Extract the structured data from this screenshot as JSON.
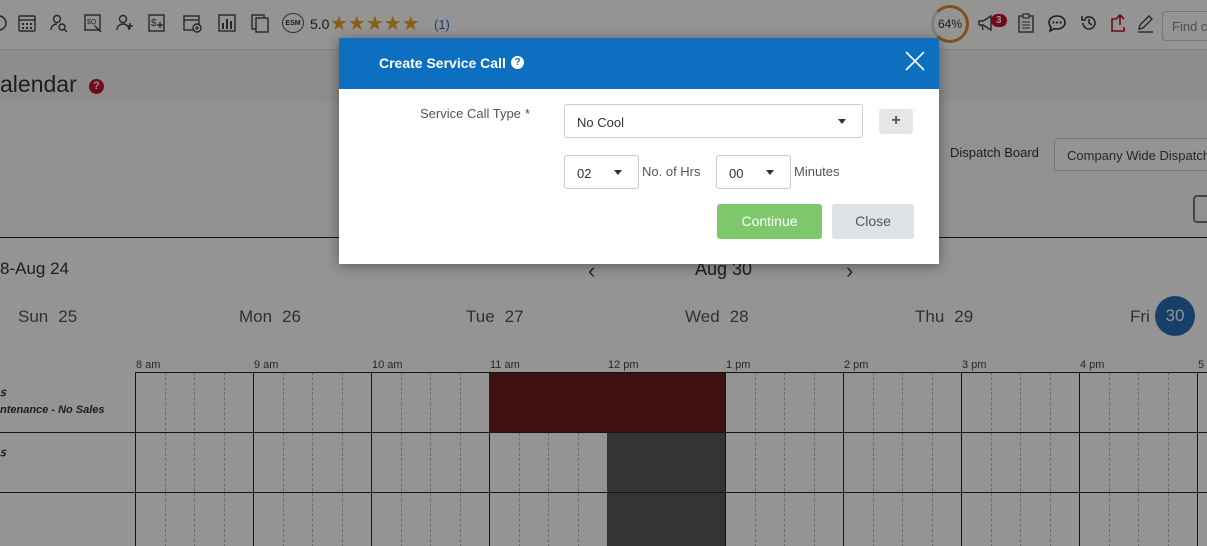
{
  "toolbar": {
    "icons": [
      "calendar-grid-icon",
      "user-search-icon",
      "search-dollar-icon",
      "add-user-icon",
      "add-dollar-icon",
      "add-calendar-icon",
      "bar-chart-icon",
      "copy-docs-icon",
      "esm-icon"
    ],
    "esm_label": "ESM",
    "rating_value": "5.0",
    "stars": "★★★★★",
    "rating_count": "(1)",
    "progress_label": "64%",
    "progress_value": 64,
    "notification_count": "3",
    "search_placeholder": "Find c"
  },
  "page": {
    "title": "alendar",
    "help_glyph": "?",
    "dispatch_board_label": "Dispatch Board",
    "dispatch_board_value": "Company Wide Dispatch"
  },
  "calendar": {
    "week_range": "8-Aug 24",
    "month_title": "Aug 30",
    "prev_glyph": "‹",
    "next_glyph": "›",
    "days": [
      {
        "name": "Sun",
        "num": "25"
      },
      {
        "name": "Mon",
        "num": "26"
      },
      {
        "name": "Tue",
        "num": "27"
      },
      {
        "name": "Wed",
        "num": "28"
      },
      {
        "name": "Thu",
        "num": "29"
      },
      {
        "name": "Fri",
        "num": ""
      }
    ],
    "today_num": "30",
    "hours": [
      "8 am",
      "9 am",
      "10 am",
      "11 am",
      "12 pm",
      "1 pm",
      "2 pm",
      "3 pm",
      "4 pm",
      "5"
    ],
    "rows": [
      {
        "label_line1": "ꜱ",
        "label_line2": "ntenance - No Sales"
      },
      {
        "label_line1": "ꜱ",
        "label_line2": ""
      },
      {
        "label_line1": "",
        "label_line2": ""
      }
    ],
    "colors": {
      "event_red": "#6e1a1a",
      "event_gray": "#5a5a5a",
      "today": "#2a6db7"
    }
  },
  "modal": {
    "title": "Create Service Call",
    "help_glyph": "?",
    "service_type_label": "Service Call Type",
    "required_mark": "*",
    "service_type_value": "No Cool",
    "add_glyph": "+",
    "hours_value": "02",
    "hours_label": "No. of Hrs",
    "minutes_value": "00",
    "minutes_label": "Minutes",
    "continue_label": "Continue",
    "close_label": "Close",
    "colors": {
      "header": "#0c6fc0",
      "continue": "#7ec86c",
      "close": "#dfe2e6"
    }
  }
}
